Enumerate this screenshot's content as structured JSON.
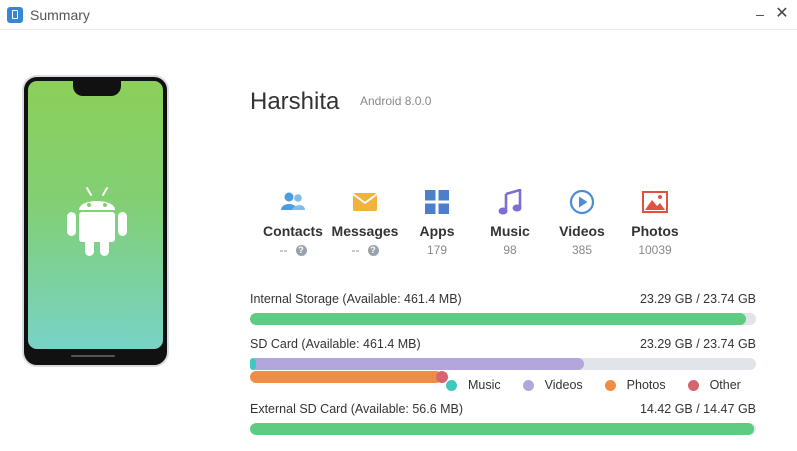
{
  "window": {
    "title": "Summary",
    "minimize_symbol": "–",
    "close_symbol": "✕"
  },
  "device": {
    "name": "Harshita",
    "os": "Android 8.0.0"
  },
  "stats": [
    {
      "icon": "contacts-icon",
      "label": "Contacts",
      "value": "--",
      "help": "?",
      "color": "#4a9ee0"
    },
    {
      "icon": "messages-icon",
      "label": "Messages",
      "value": "--",
      "help": "?",
      "color": "#f1b33d"
    },
    {
      "icon": "apps-icon",
      "label": "Apps",
      "value": "179",
      "color": "#4b7fc9"
    },
    {
      "icon": "music-icon",
      "label": "Music",
      "value": "98",
      "color": "#7b6fd1"
    },
    {
      "icon": "videos-icon",
      "label": "Videos",
      "value": "385",
      "color": "#4a8dd6"
    },
    {
      "icon": "photos-icon",
      "label": "Photos",
      "value": "10039",
      "color": "#e0513f"
    }
  ],
  "storage": {
    "internal": {
      "label": "Internal Storage (Available: 461.4 MB)",
      "usage": "23.29 GB / 23.74 GB",
      "used_fraction": 0.981,
      "color": "#5dcc82"
    },
    "sd": {
      "label": "SD Card (Available: 461.4 MB)",
      "usage": "23.29 GB / 23.74 GB",
      "segments": [
        {
          "name": "Music",
          "fraction": 0.01,
          "color": "#3ec8c0"
        },
        {
          "name": "Videos",
          "fraction": 0.66,
          "color": "#b3a6dc"
        },
        {
          "name": "Photos",
          "fraction": 0.38,
          "color": "#ee8d48"
        },
        {
          "name": "Other",
          "fraction": 0.01,
          "color": "#d5666f"
        }
      ]
    },
    "external": {
      "label": "External SD Card (Available: 56.6 MB)",
      "usage": "14.42 GB / 14.47 GB",
      "used_fraction": 0.996,
      "color": "#5dcc82"
    }
  },
  "legend": [
    {
      "label": "Music",
      "color": "#3ec8c0"
    },
    {
      "label": "Videos",
      "color": "#b3a6dc"
    },
    {
      "label": "Photos",
      "color": "#ee8d48"
    },
    {
      "label": "Other",
      "color": "#d5666f"
    }
  ]
}
